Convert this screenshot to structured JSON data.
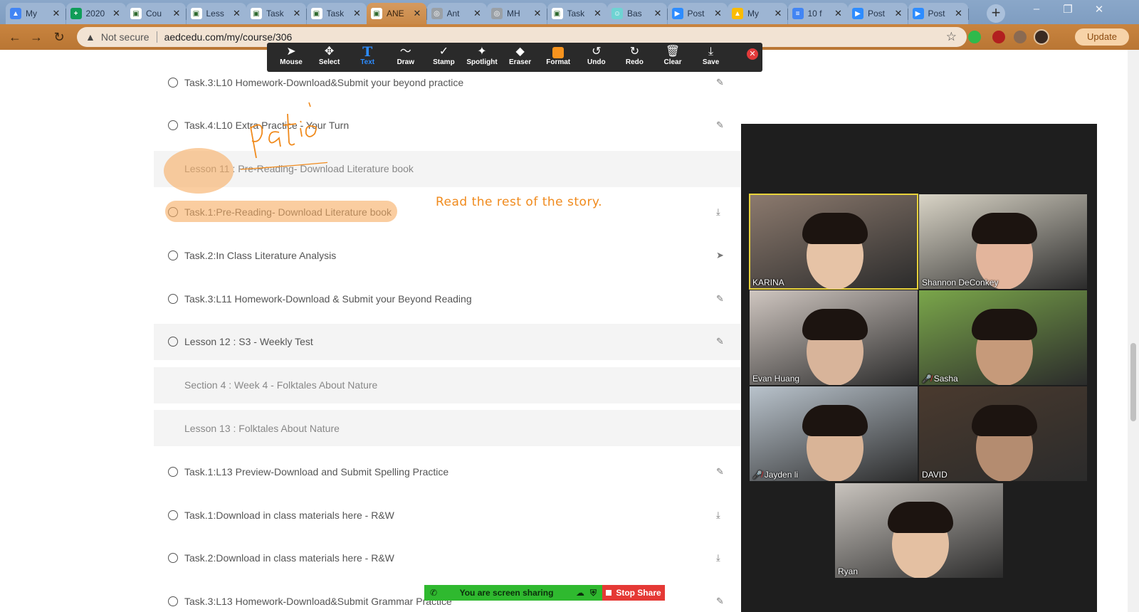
{
  "browser": {
    "tabs": [
      {
        "title": "My",
        "color": "#4285f4",
        "glyph": "▲"
      },
      {
        "title": "2020",
        "color": "#0f9d58",
        "glyph": "+"
      },
      {
        "title": "Cou",
        "color": "#ffffff",
        "glyph": "▣"
      },
      {
        "title": "Less",
        "color": "#ffffff",
        "glyph": "▣"
      },
      {
        "title": "Task",
        "color": "#ffffff",
        "glyph": "▣"
      },
      {
        "title": "Task",
        "color": "#ffffff",
        "glyph": "▣"
      },
      {
        "title": "ANE",
        "color": "#ffffff",
        "glyph": "▣"
      },
      {
        "title": "Ant",
        "color": "#9aa0a6",
        "glyph": "◎"
      },
      {
        "title": "MH",
        "color": "#9aa0a6",
        "glyph": "◎"
      },
      {
        "title": "Task",
        "color": "#ffffff",
        "glyph": "▣"
      },
      {
        "title": "Bas",
        "color": "#6fd3d3",
        "glyph": "☺"
      },
      {
        "title": "Post",
        "color": "#2d8cff",
        "glyph": "▶"
      },
      {
        "title": "My",
        "color": "#fbbc04",
        "glyph": "▲"
      },
      {
        "title": "10 f",
        "color": "#4285f4",
        "glyph": "≡"
      },
      {
        "title": "Post",
        "color": "#2d8cff",
        "glyph": "▶"
      },
      {
        "title": "Post",
        "color": "#2d8cff",
        "glyph": "▶"
      }
    ],
    "active_tab_index": 6,
    "security_label": "Not secure",
    "url": "aedcedu.com/my/course/306",
    "update_label": "Update"
  },
  "zoom_toolbar": {
    "tools": [
      {
        "label": "Mouse",
        "icon": "mouse-pointer-icon",
        "glyph": "➤"
      },
      {
        "label": "Select",
        "icon": "move-icon",
        "glyph": "✥"
      },
      {
        "label": "Text",
        "icon": "text-icon",
        "glyph": "T"
      },
      {
        "label": "Draw",
        "icon": "draw-icon",
        "glyph": "〜"
      },
      {
        "label": "Stamp",
        "icon": "stamp-check-icon",
        "glyph": "✓"
      },
      {
        "label": "Spotlight",
        "icon": "spotlight-wand-icon",
        "glyph": "✦"
      },
      {
        "label": "Eraser",
        "icon": "eraser-icon",
        "glyph": "◆"
      },
      {
        "label": "Format",
        "icon": "format-color-icon",
        "glyph": ""
      },
      {
        "label": "Undo",
        "icon": "undo-icon",
        "glyph": "↺"
      },
      {
        "label": "Redo",
        "icon": "redo-icon",
        "glyph": "↻"
      },
      {
        "label": "Clear",
        "icon": "trash-icon",
        "glyph": "🗑"
      },
      {
        "label": "Save",
        "icon": "save-download-icon",
        "glyph": "⤓"
      }
    ],
    "active_tool": "Text",
    "format_color": "#f7931e"
  },
  "course_list": [
    {
      "label": "Task.3:L10 Homework-Download&Submit your beyond practice",
      "type": "task",
      "action": "edit"
    },
    {
      "label": "Task.4:L10 Extra Practice - Your Turn",
      "type": "task",
      "action": "edit"
    },
    {
      "label": "Lesson 11 : Pre-Reading- Download Literature book",
      "type": "lesson",
      "action": ""
    },
    {
      "label": "Task.1:Pre-Reading- Download Literature book",
      "type": "task",
      "action": "download"
    },
    {
      "label": "Task.2:In Class Literature Analysis",
      "type": "task",
      "action": "send"
    },
    {
      "label": "Task.3:L11 Homework-Download & Submit your Beyond Reading",
      "type": "task",
      "action": "edit"
    },
    {
      "label": "Lesson 12 : S3 - Weekly Test",
      "type": "lesson-task",
      "action": "edit"
    },
    {
      "label": "Section 4 : Week 4 - Folktales About Nature",
      "type": "section",
      "action": ""
    },
    {
      "label": "Lesson 13 : Folktales About Nature",
      "type": "lesson",
      "action": ""
    },
    {
      "label": "Task.1:L13 Preview-Download and Submit Spelling Practice",
      "type": "task",
      "action": "edit"
    },
    {
      "label": "Task.1:Download in class materials here - R&W",
      "type": "task",
      "action": "download"
    },
    {
      "label": "Task.2:Download in class materials here - R&W",
      "type": "task",
      "action": "download"
    },
    {
      "label": "Task.3:L13 Homework-Download&Submit Grammar Practice",
      "type": "task",
      "action": "edit"
    }
  ],
  "annotations": {
    "typed_text": "Read the rest of the story.",
    "handwriting": "patio",
    "ink_color": "#f08a1c"
  },
  "participants": [
    {
      "name": "KARINA",
      "muted": false,
      "speaking": true,
      "bg": "#8c7a6e",
      "skin": "#e6c3a6"
    },
    {
      "name": "Shannon DeConkey",
      "muted": false,
      "speaking": false,
      "bg": "#d9d4c6",
      "skin": "#e3b59c"
    },
    {
      "name": "Evan Huang",
      "muted": false,
      "speaking": false,
      "bg": "#cfc6c0",
      "skin": "#d8b49a"
    },
    {
      "name": "Sasha",
      "muted": true,
      "speaking": false,
      "bg": "#7aa64a",
      "skin": "#c69a7a"
    },
    {
      "name": "Jayden li",
      "muted": true,
      "speaking": false,
      "bg": "#b9c3cc",
      "skin": "#d9b497"
    },
    {
      "name": "DAVID",
      "muted": false,
      "speaking": false,
      "bg": "#4a3a2e",
      "skin": "#b48c70"
    },
    {
      "name": "Ryan",
      "muted": false,
      "speaking": false,
      "bg": "#c9c4be",
      "skin": "#e4c0a2"
    }
  ],
  "share_bar": {
    "status": "You are screen sharing",
    "stop_label": "Stop Share"
  }
}
